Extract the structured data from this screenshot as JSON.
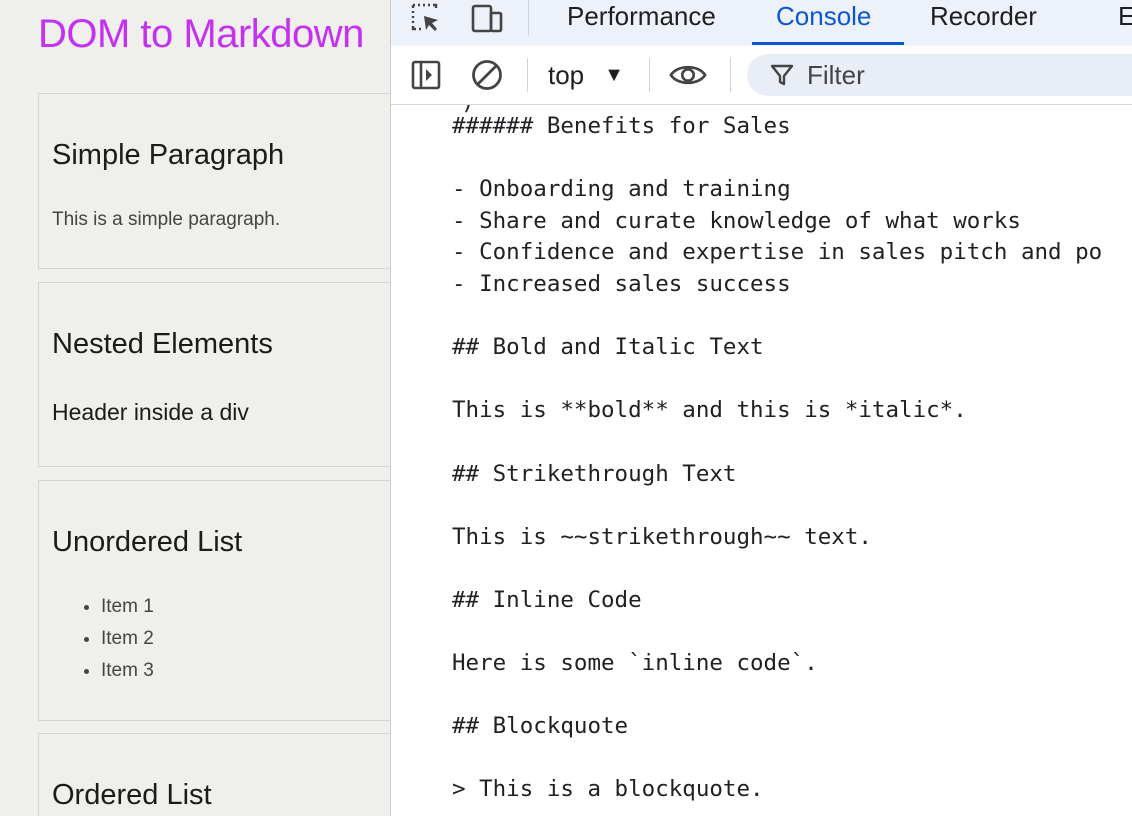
{
  "page": {
    "title": "DOM to Markdown",
    "sections": [
      {
        "heading": "Simple Paragraph",
        "text": "This is a simple paragraph."
      },
      {
        "heading": "Nested Elements",
        "subheading": "Header inside a div"
      },
      {
        "heading": "Unordered List",
        "items": [
          "Item 1",
          "Item 2",
          "Item 3"
        ]
      },
      {
        "heading": "Ordered List"
      }
    ]
  },
  "devtools": {
    "tabs": [
      {
        "label": "Performance"
      },
      {
        "label": "Console"
      },
      {
        "label": "Recorder"
      },
      {
        "label": "E"
      }
    ],
    "active_tab": "Console",
    "context": "top",
    "filter_placeholder": "Filter",
    "icons": [
      "inspect-element-icon",
      "device-toolbar-icon",
      "sidebar-toggle-icon",
      "clear-console-icon",
      "live-expression-eye-icon",
      "filter-funnel-icon"
    ],
    "accent_color": "#0b57d0",
    "console_output": "###### Benefits for Sales\n\n- Onboarding and training\n- Share and curate knowledge of what works\n- Confidence and expertise in sales pitch and po\n- Increased sales success\n\n## Bold and Italic Text\n\nThis is **bold** and this is *italic*.\n\n## Strikethrough Text\n\nThis is ~~strikethrough~~ text.\n\n## Inline Code\n\nHere is some `inline code`.\n\n## Blockquote\n\n> This is a blockquote."
  },
  "colors": {
    "title": "#c531f1",
    "page_bg": "#efefeb",
    "devtools_tabbar_bg": "#edf2fa"
  }
}
